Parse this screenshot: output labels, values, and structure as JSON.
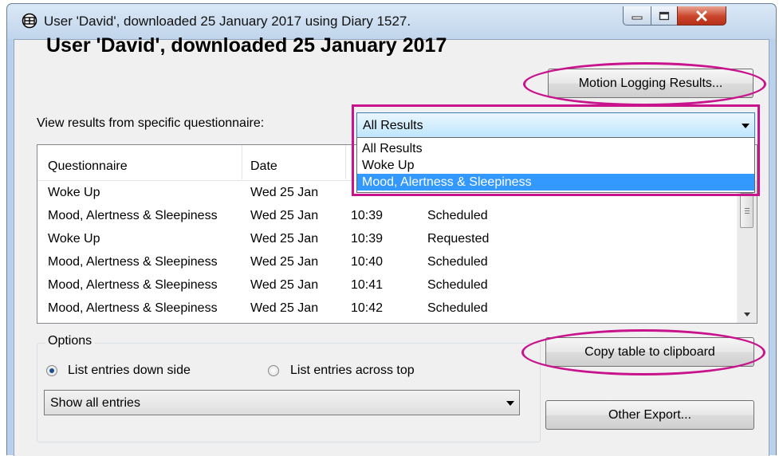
{
  "window": {
    "title": "User 'David', downloaded 25 January 2017 using Diary 1527."
  },
  "header": {
    "heading": "User 'David', downloaded 25 January 2017",
    "motion_button": "Motion Logging Results..."
  },
  "questionnaire_filter": {
    "label": "View results from specific questionnaire:",
    "selected": "All Results",
    "options": [
      "All Results",
      "Woke Up",
      "Mood, Alertness & Sleepiness"
    ],
    "highlighted_option": "Mood, Alertness & Sleepiness"
  },
  "table": {
    "columns": [
      "Questionnaire",
      "Date",
      "",
      ""
    ],
    "rows": [
      [
        "Woke Up",
        "Wed 25 Jan",
        "",
        ""
      ],
      [
        "Mood, Alertness & Sleepiness",
        "Wed 25 Jan",
        "10:39",
        "Scheduled"
      ],
      [
        "Woke Up",
        "Wed 25 Jan",
        "10:39",
        "Requested"
      ],
      [
        "Mood, Alertness & Sleepiness",
        "Wed 25 Jan",
        "10:40",
        "Scheduled"
      ],
      [
        "Mood, Alertness & Sleepiness",
        "Wed 25 Jan",
        "10:41",
        "Scheduled"
      ],
      [
        "Mood, Alertness & Sleepiness",
        "Wed 25 Jan",
        "10:42",
        "Scheduled"
      ]
    ]
  },
  "options": {
    "group_title": "Options",
    "radio_down": "List entries down side",
    "radio_across": "List entries across top",
    "selected_radio": "List entries down side",
    "entries_filter": "Show all entries"
  },
  "buttons": {
    "copy": "Copy table to clipboard",
    "export": "Other Export..."
  },
  "colors": {
    "annotation": "#c8138c",
    "selection": "#3399ff"
  },
  "icons": [
    "app-icon",
    "minimize-icon",
    "maximize-icon",
    "close-icon",
    "chevron-down-icon"
  ]
}
